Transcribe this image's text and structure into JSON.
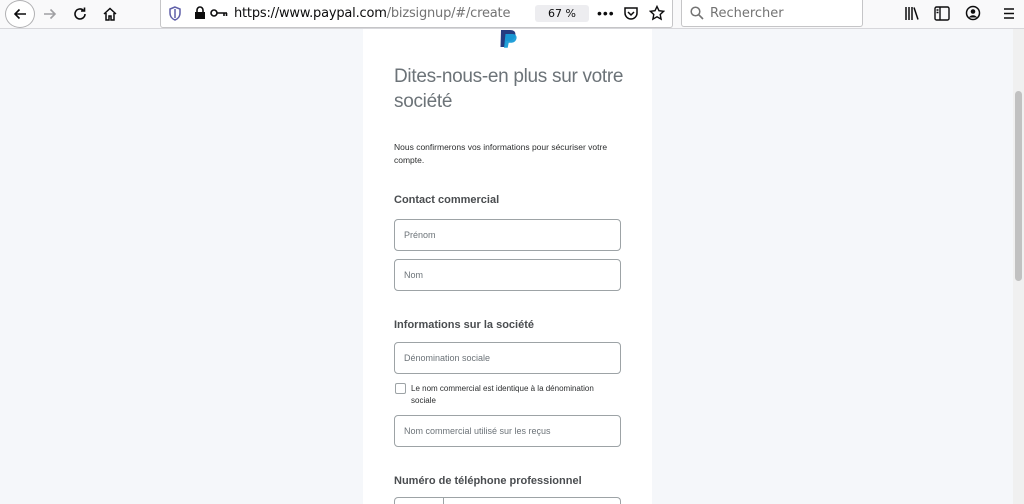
{
  "browser": {
    "url_host": "https://www.paypal.com",
    "url_path": "/bizsignup/#/create",
    "zoom": "67 %",
    "search_placeholder": "Rechercher"
  },
  "page": {
    "title": "Dites-nous-en plus sur votre société",
    "intro": "Nous confirmerons vos informations pour sécuriser votre compte.",
    "sections": {
      "contact": "Contact commercial",
      "company": "Informations sur la société",
      "phone": "Numéro de téléphone professionnel"
    },
    "fields": {
      "first_name": "Prénom",
      "last_name": "Nom",
      "company_name": "Dénomination sociale",
      "trade_name": "Nom commercial utilisé sur les reçus"
    },
    "checkbox_label": "Le nom commercial est identique à la dénomination sociale"
  },
  "colors": {
    "paypal_dark": "#253b80",
    "paypal_light": "#179bd7"
  }
}
